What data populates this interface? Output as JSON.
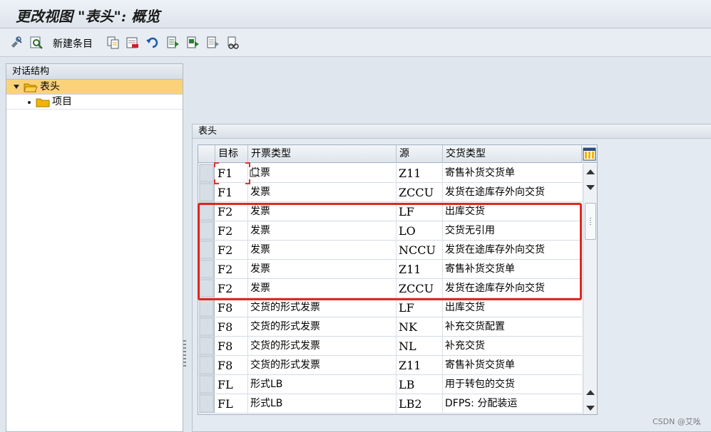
{
  "window": {
    "title": "更改视图 \"表头\": 概览"
  },
  "toolbar": {
    "new_entries_label": "新建条目",
    "icons": [
      "display-change-icon",
      "find-icon",
      "copy-icon",
      "delete-icon",
      "undo-icon",
      "select-all-icon",
      "select-block-icon",
      "deselect-icon",
      "more-icon"
    ]
  },
  "dialog_structure": {
    "title": "对话结构",
    "items": [
      {
        "label": "表头",
        "selected": true,
        "icon": "folder-open-icon"
      },
      {
        "label": "项目",
        "selected": false,
        "icon": "folder-icon"
      }
    ]
  },
  "group": {
    "title": "表头"
  },
  "table": {
    "columns": [
      "目标",
      "开票类型",
      "源",
      "交货类型"
    ],
    "rows": [
      {
        "target": "F1",
        "billing": "发票",
        "source": "Z11",
        "delivery": "寄售补货交货单"
      },
      {
        "target": "F1",
        "billing": "发票",
        "source": "ZCCU",
        "delivery": "发货在途库存外向交货"
      },
      {
        "target": "F2",
        "billing": "发票",
        "source": "LF",
        "delivery": "出库交货"
      },
      {
        "target": "F2",
        "billing": "发票",
        "source": "LO",
        "delivery": "交货无引用"
      },
      {
        "target": "F2",
        "billing": "发票",
        "source": "NCCU",
        "delivery": "发货在途库存外向交货"
      },
      {
        "target": "F2",
        "billing": "发票",
        "source": "Z11",
        "delivery": "寄售补货交货单"
      },
      {
        "target": "F2",
        "billing": "发票",
        "source": "ZCCU",
        "delivery": "发货在途库存外向交货"
      },
      {
        "target": "F8",
        "billing": "交货的形式发票",
        "source": "LF",
        "delivery": "出库交货"
      },
      {
        "target": "F8",
        "billing": "交货的形式发票",
        "source": "NK",
        "delivery": "补充交货配置"
      },
      {
        "target": "F8",
        "billing": "交货的形式发票",
        "source": "NL",
        "delivery": "补充交货"
      },
      {
        "target": "F8",
        "billing": "交货的形式发票",
        "source": "Z11",
        "delivery": "寄售补货交货单"
      },
      {
        "target": "FL",
        "billing": "形式LB",
        "source": "LB",
        "delivery": "用于转包的交货"
      },
      {
        "target": "FL",
        "billing": "形式LB",
        "source": "LB2",
        "delivery": "DFPS: 分配装运"
      }
    ]
  },
  "colors": {
    "highlight": "#e0261c",
    "selected_node": "#f9d27a",
    "folder": "#f2b400"
  },
  "watermark": "CSDN @艾吆"
}
